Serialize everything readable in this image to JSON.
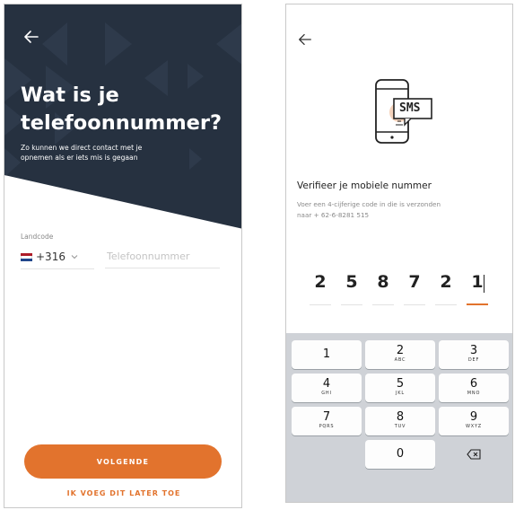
{
  "phone_screen": {
    "title_line1": "Wat is je",
    "title_line2": "telefoonnummer?",
    "subtitle_line1": "Zo kunnen we direct contact met je",
    "subtitle_line2": "opnemen als er iets mis is gegaan",
    "country_label": "Landcode",
    "country_code": "+316",
    "phone_placeholder": "Telefoonnummer",
    "next_button": "VOLGENDE",
    "later_link": "IK VOEG DIT LATER TOE",
    "accent_color": "#e2732d",
    "hero_color": "#263140",
    "flag_colors": [
      "#ae1c28",
      "#ffffff",
      "#21468b"
    ]
  },
  "verify_screen": {
    "sms_label": "SMS",
    "title": "Verifieer je mobiele nummer",
    "subtitle_line1": "Voer een 4-cijferige code in die is verzonden",
    "subtitle_line2": "naar + 62-6-8281 515",
    "code_digits": [
      "2",
      "5",
      "8",
      "7",
      "2",
      "1"
    ],
    "active_index": 5
  },
  "keypad": {
    "keys": [
      {
        "num": "1",
        "letters": ""
      },
      {
        "num": "2",
        "letters": "ABC"
      },
      {
        "num": "3",
        "letters": "DEF"
      },
      {
        "num": "4",
        "letters": "GHI"
      },
      {
        "num": "5",
        "letters": "JKL"
      },
      {
        "num": "6",
        "letters": "MNO"
      },
      {
        "num": "7",
        "letters": "PQRS"
      },
      {
        "num": "8",
        "letters": "TUV"
      },
      {
        "num": "9",
        "letters": "WXYZ"
      },
      {
        "num": "0",
        "letters": ""
      }
    ],
    "delete_icon": "backspace-icon"
  }
}
